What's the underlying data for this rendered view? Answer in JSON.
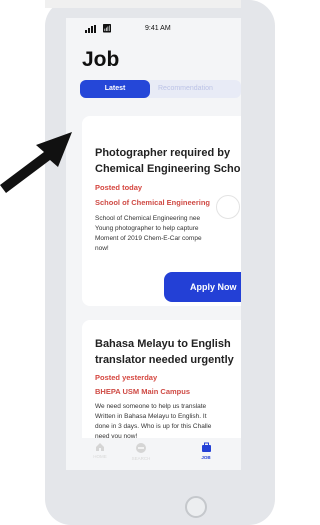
{
  "status_bar": {
    "time": "9:41 AM"
  },
  "page": {
    "title": "Job"
  },
  "tabs": [
    {
      "label": "Latest",
      "active": true
    },
    {
      "label": "Recommendation",
      "active": false
    }
  ],
  "jobs": [
    {
      "title_lines": [
        "Photographer required by",
        "Chemical Engineering Scho"
      ],
      "posted": "Posted today",
      "location": "School of Chemical Engineering",
      "description_lines": [
        "School of Chemical Engineering nee",
        "Young photographer to help capture",
        "Moment of 2019 Chem-E-Car compe",
        "now!"
      ],
      "apply_label": "Apply Now"
    },
    {
      "title_lines": [
        "Bahasa Melayu to English",
        "translator needed urgently"
      ],
      "posted": "Posted yesterday",
      "location": "BHEPA USM Main Campus",
      "description_lines": [
        "We need someone to help us translate",
        "Written in Bahasa Melayu to English. It",
        "done in 3 days. Who is up for this Challe",
        "need you now!"
      ]
    }
  ],
  "bottom_nav": [
    {
      "label": "HOME",
      "icon": "home-icon",
      "active": false
    },
    {
      "label": "SEARCH",
      "icon": "chat-bubble-icon",
      "active": false
    },
    {
      "label": "JOB",
      "icon": "briefcase-icon",
      "active": true
    }
  ],
  "colors": {
    "accent": "#2340d6",
    "meta_red": "#d5463f",
    "screen_bg": "#f4f5f7"
  }
}
